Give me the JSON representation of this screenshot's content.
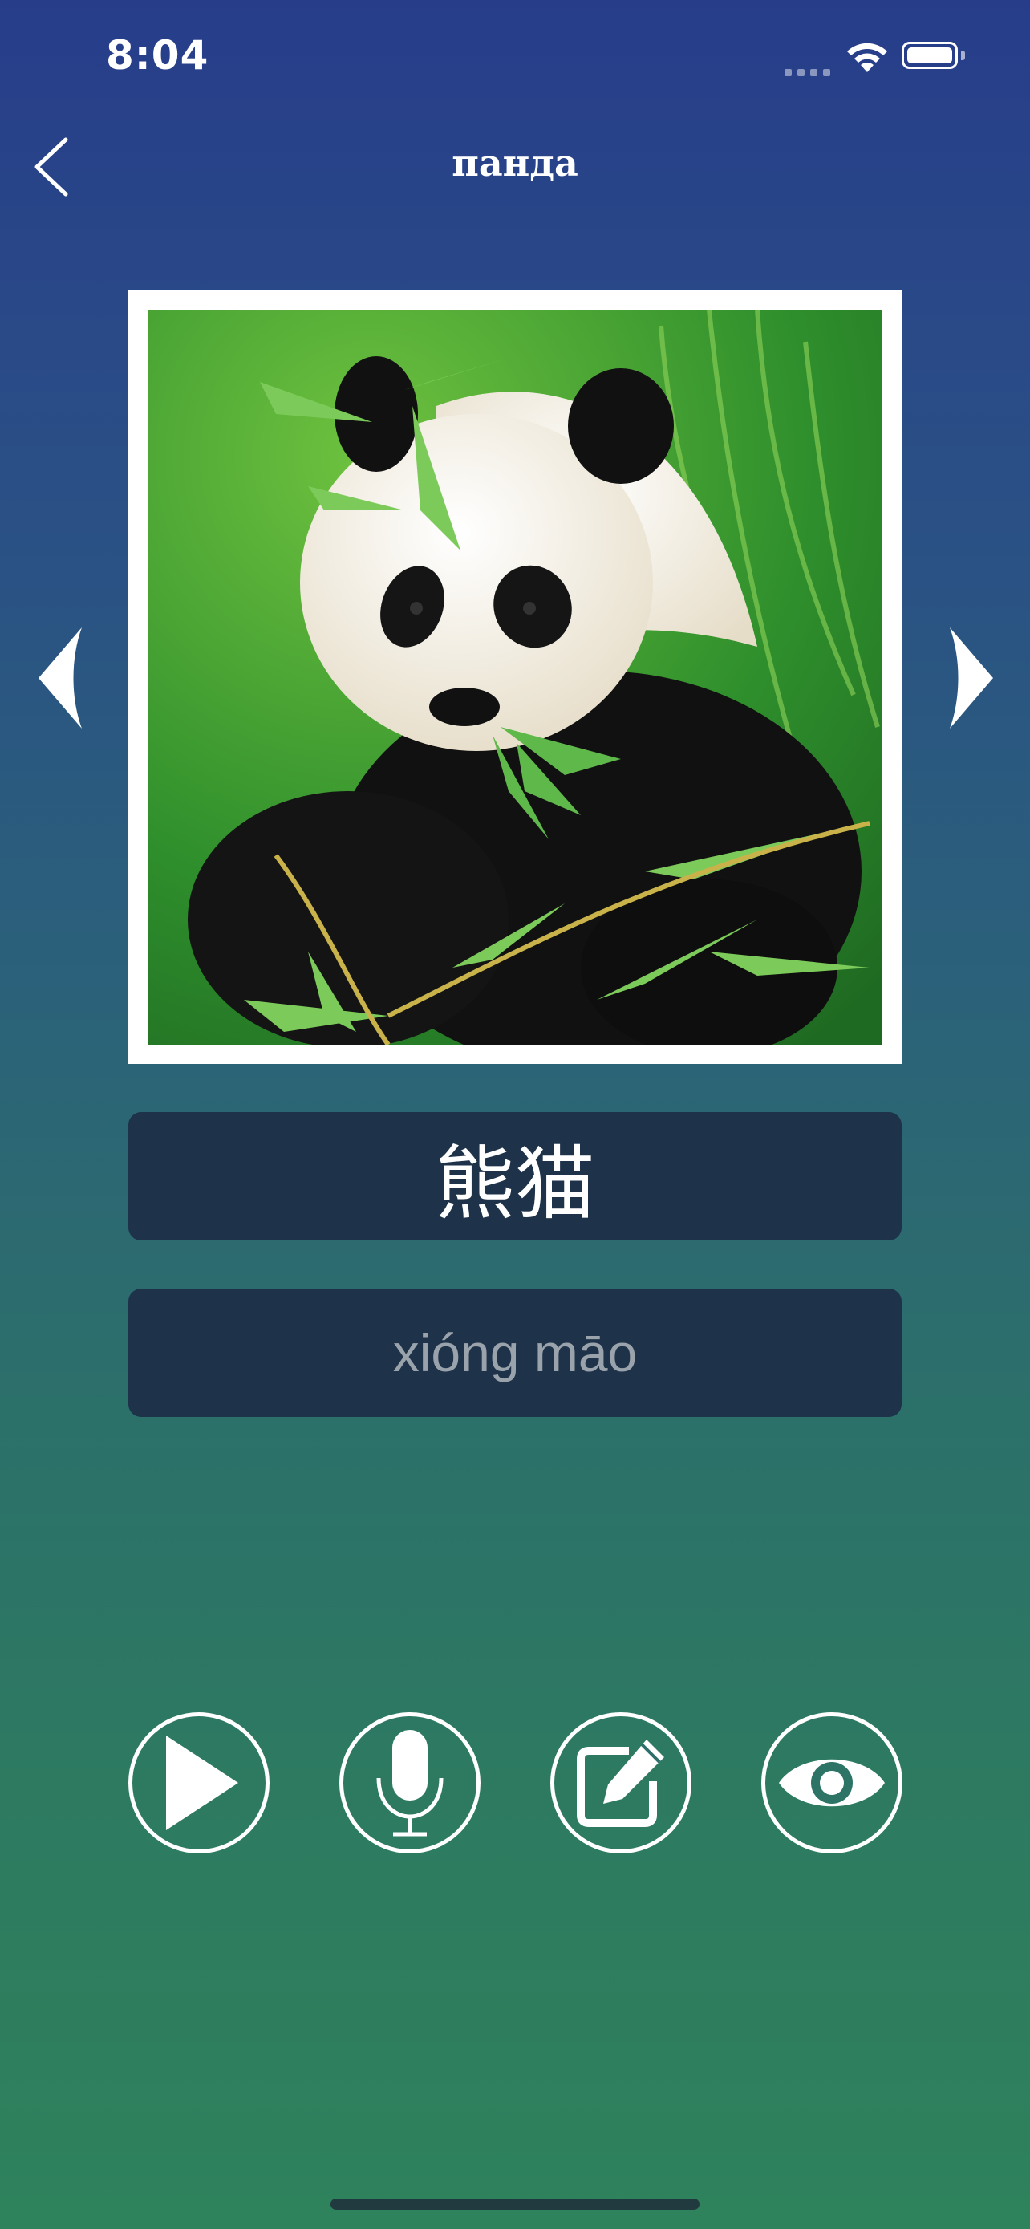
{
  "status_bar": {
    "time": "8:04"
  },
  "nav": {
    "title": "панда",
    "back_icon": "chevron-left-icon"
  },
  "card": {
    "image_subject": "panda",
    "hanzi": "熊猫",
    "pinyin": "xióng māo"
  },
  "navigation_arrows": {
    "prev_icon": "triangle-left-icon",
    "next_icon": "triangle-right-icon"
  },
  "actions": [
    {
      "icon": "play-icon"
    },
    {
      "icon": "microphone-icon"
    },
    {
      "icon": "edit-icon"
    },
    {
      "icon": "eye-icon"
    }
  ],
  "colors": {
    "gradient_top": "#273d8a",
    "gradient_bottom": "#2e825c",
    "card_bg": "#1e3249",
    "pinyin_text": "#9aa3ab"
  }
}
